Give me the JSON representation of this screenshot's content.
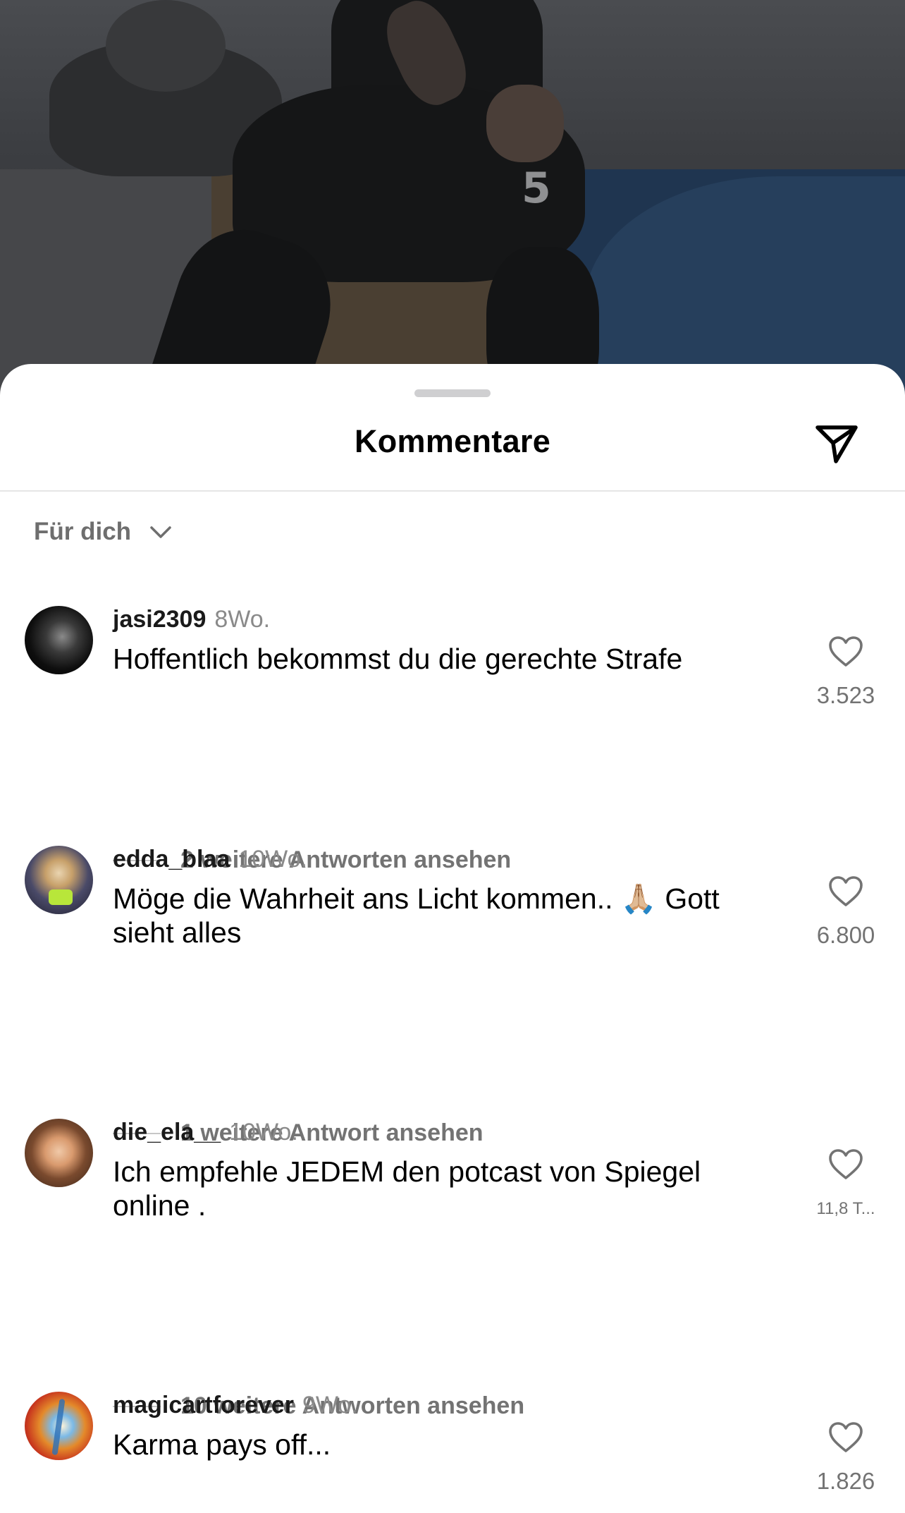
{
  "background": {
    "jersey_number": "5"
  },
  "sheet": {
    "title": "Kommentare",
    "share_icon": "paper-plane-icon",
    "filter": {
      "label": "Für dich",
      "icon": "chevron-down-icon"
    }
  },
  "comments": [
    {
      "username": "jasi2309",
      "time": "8Wo.",
      "text": "Hoffentlich bekommst du die gerechte Strafe",
      "likes": "3.523",
      "replies": "2 weitere Antworten ansehen"
    },
    {
      "username": "edda_blaa",
      "time": "10Wo.",
      "text_before": "Möge die Wahrheit ans Licht kommen.. ",
      "emoji": "🙏🏼",
      "text_after": " Gott sieht alles",
      "likes": "6.800",
      "replies": "1 weitere Antwort ansehen"
    },
    {
      "username": "die_ela__",
      "time": "10Wo.",
      "text": "Ich empfehle JEDEM den potcast von Spiegel online .",
      "likes": "11,8 T...",
      "replies": "10 weitere Antworten ansehen"
    },
    {
      "username": "magicartforever",
      "time": "9Wo.",
      "text": "Karma pays off...",
      "likes": "1.826"
    }
  ],
  "colors": {
    "sheet_bg": "#ffffff",
    "secondary_text": "#737373",
    "primary_text": "#000000"
  }
}
